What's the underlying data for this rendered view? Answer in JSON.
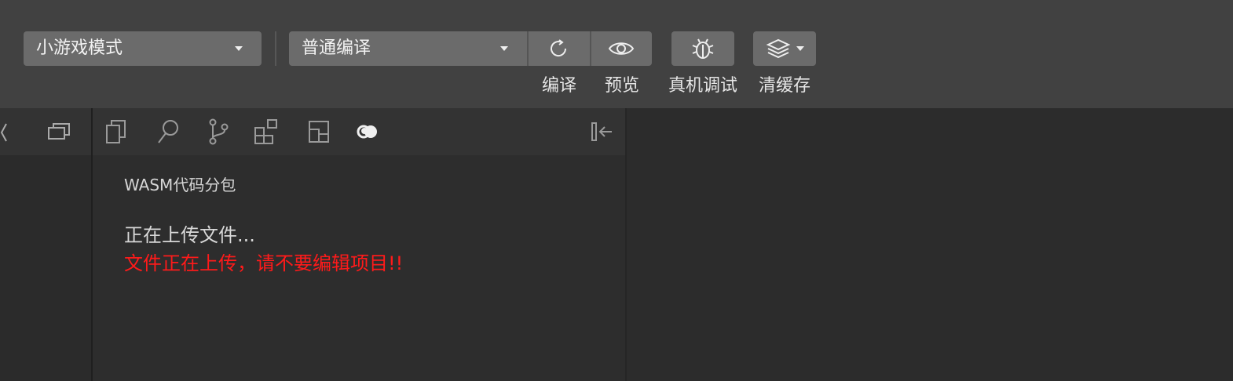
{
  "toolbar": {
    "mode_select": {
      "value": "小游戏模式"
    },
    "compile_select": {
      "value": "普通编译"
    },
    "buttons": {
      "compile": {
        "label": "编译",
        "icon": "refresh-icon"
      },
      "preview": {
        "label": "预览",
        "icon": "eye-icon"
      },
      "remote_debug": {
        "label": "真机调试",
        "icon": "bug-icon"
      },
      "clear_cache": {
        "label": "清缓存",
        "icon": "layers-icon"
      }
    }
  },
  "side_tabs": [
    {
      "name": "explorer",
      "icon": "copy-files-icon"
    },
    {
      "name": "search",
      "icon": "search-icon"
    },
    {
      "name": "source-control",
      "icon": "git-branch-icon"
    },
    {
      "name": "extensions",
      "icon": "extensions-icon"
    },
    {
      "name": "outline",
      "icon": "layout-icon"
    },
    {
      "name": "upload",
      "icon": "upload-icon"
    }
  ],
  "panel": {
    "section_title": "WASM代码分包",
    "status": "正在上传文件...",
    "warning": "文件正在上传，请不要编辑项目!!"
  },
  "colors": {
    "toolbar_bg": "#414141",
    "button_bg": "#6b6b6b",
    "warning": "#ff1a1a"
  }
}
